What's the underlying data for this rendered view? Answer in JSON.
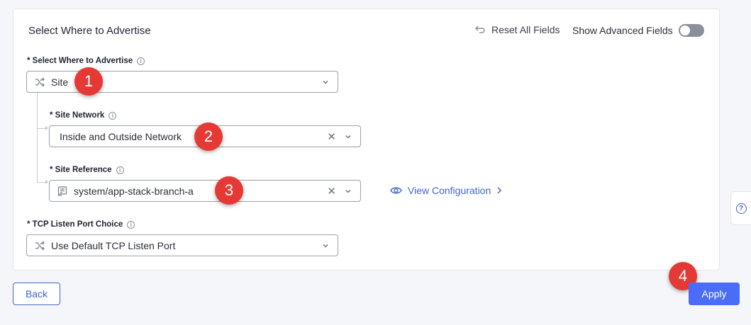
{
  "panel": {
    "title": "Select Where to Advertise",
    "reset_label": "Reset All Fields",
    "advanced_label": "Show Advanced Fields",
    "advanced_enabled": false
  },
  "fields": {
    "where": {
      "label": "* Select Where to Advertise",
      "value": "Site"
    },
    "site_network": {
      "label": "* Site Network",
      "value": "Inside and Outside Network"
    },
    "site_reference": {
      "label": "* Site Reference",
      "value": "system/app-stack-branch-a",
      "view_label": "View Configuration"
    },
    "tcp_port": {
      "label": "* TCP Listen Port Choice",
      "value": "Use Default TCP Listen Port"
    }
  },
  "badges": [
    "1",
    "2",
    "3",
    "4"
  ],
  "footer": {
    "back_label": "Back",
    "apply_label": "Apply"
  },
  "icons": {
    "info": "info-icon",
    "reset": "undo-icon",
    "choice": "shuffle-icon",
    "reference": "document-list-icon",
    "view": "eye-icon",
    "help": "help-icon"
  },
  "colors": {
    "accent": "#4a6cf7",
    "link": "#3f66c9",
    "badge": "#e53935"
  }
}
